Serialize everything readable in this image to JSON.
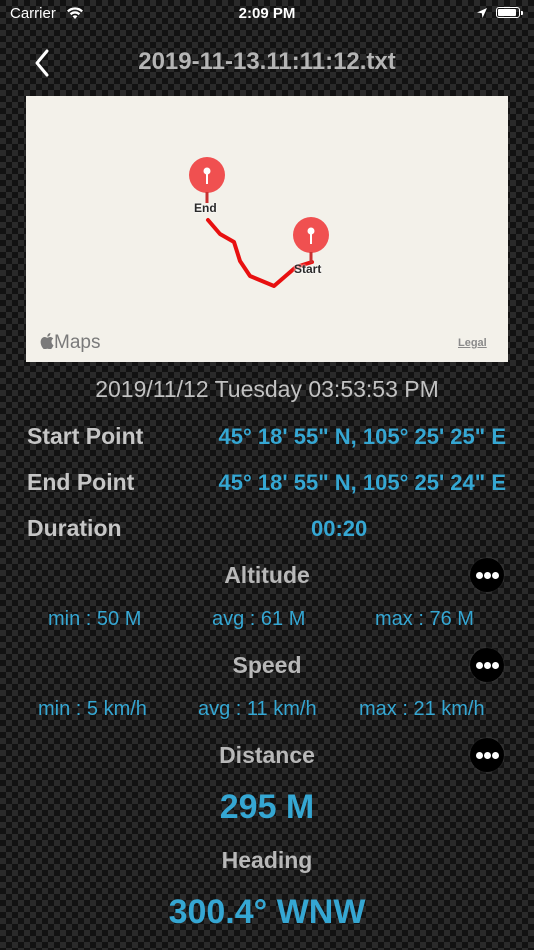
{
  "status_bar": {
    "carrier": "Carrier",
    "time": "2:09 PM"
  },
  "nav": {
    "title": "2019-11-13.11:11:12.txt"
  },
  "map": {
    "end_label": "End",
    "start_label": "Start",
    "logo": "Maps",
    "legal": "Legal"
  },
  "recording": {
    "datetime": "2019/11/12 Tuesday 03:53:53 PM"
  },
  "start_point": {
    "label": "Start Point",
    "value": "45° 18' 55\" N, 105° 25' 25\" E"
  },
  "end_point": {
    "label": "End Point",
    "value": "45° 18' 55\" N, 105° 25' 24\" E"
  },
  "duration": {
    "label": "Duration",
    "value": "00:20"
  },
  "altitude": {
    "title": "Altitude",
    "min": "min : 50 M",
    "avg": "avg : 61 M",
    "max": "max : 76 M"
  },
  "speed": {
    "title": "Speed",
    "min": "min : 5 km/h",
    "avg": "avg : 11 km/h",
    "max": "max : 21 km/h"
  },
  "distance": {
    "title": "Distance",
    "value": "295 M"
  },
  "heading": {
    "title": "Heading",
    "value": "300.4° WNW"
  },
  "colors": {
    "accent": "#35a7d3",
    "route": "#e81010",
    "pin": "#f05050"
  }
}
